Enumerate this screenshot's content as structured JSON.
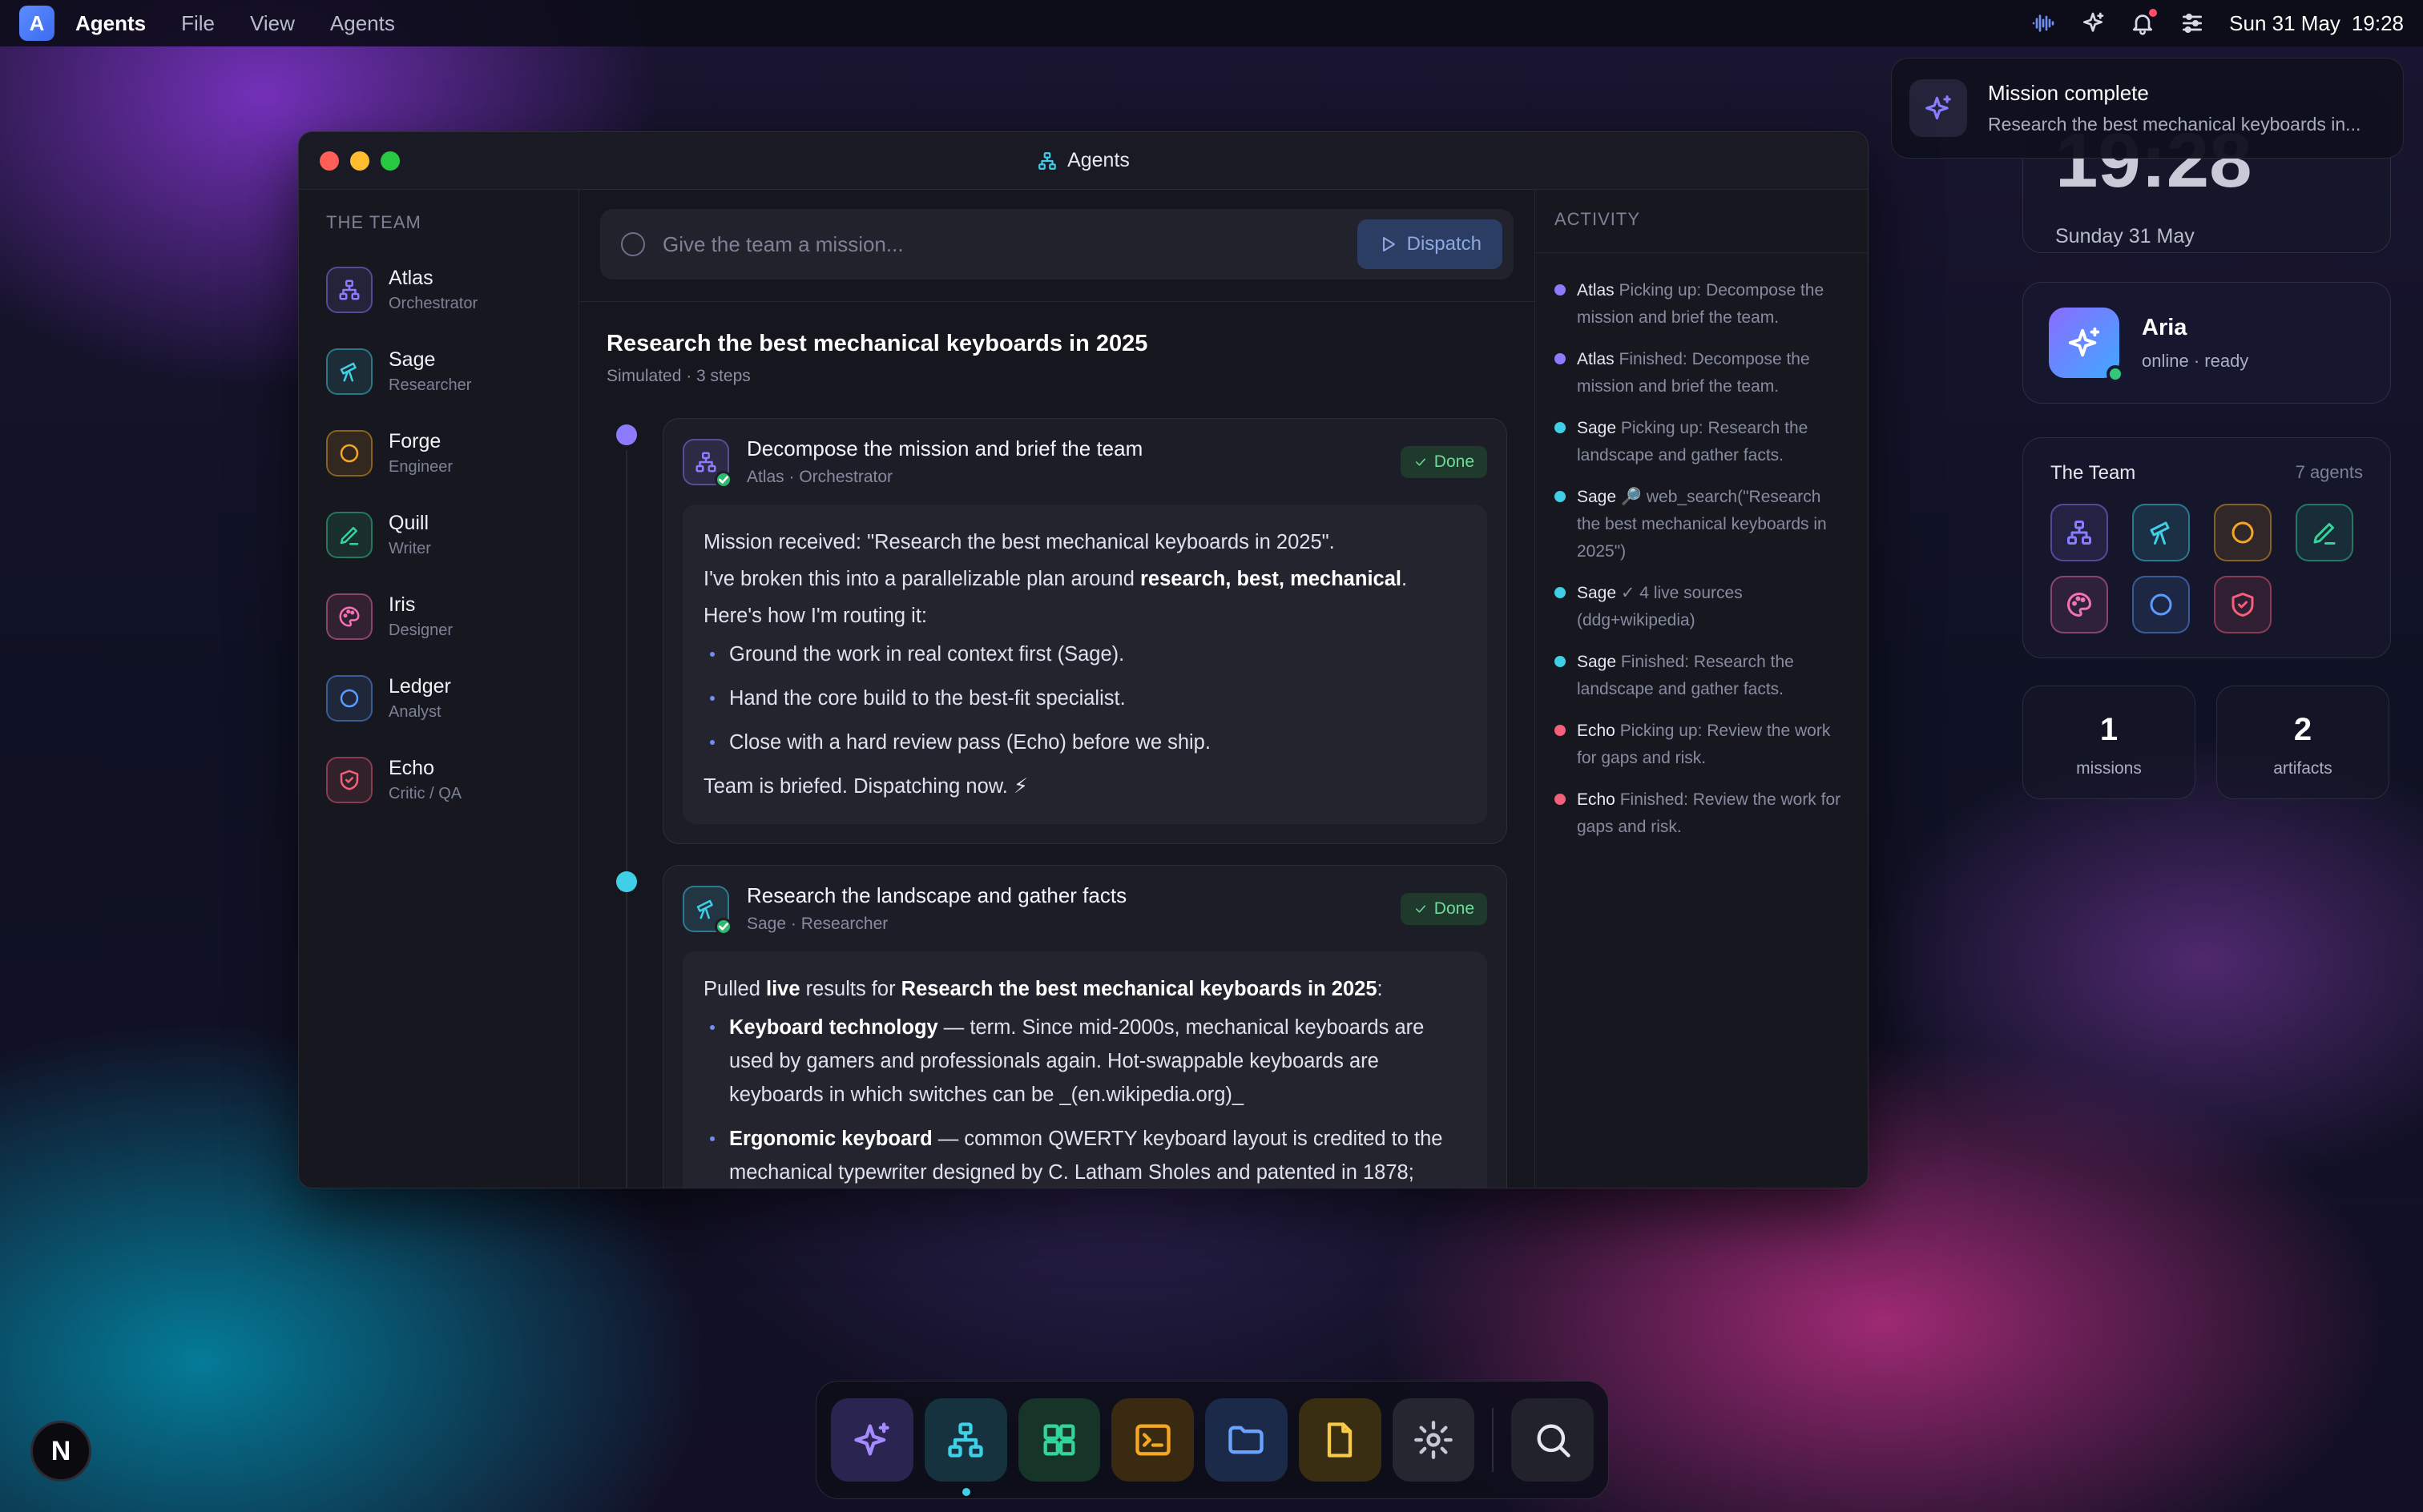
{
  "menubar": {
    "app_letter": "A",
    "app_name": "Agents",
    "menus": [
      "File",
      "View",
      "Agents"
    ],
    "date": "Sun 31 May",
    "time": "19:28"
  },
  "window": {
    "title": "Agents",
    "team_label": "THE TEAM",
    "agents": [
      {
        "name": "Atlas",
        "role": "Orchestrator",
        "color": "#8b7cff",
        "icon": "network-icon"
      },
      {
        "name": "Sage",
        "role": "Researcher",
        "color": "#3fd0e8",
        "icon": "telescope-icon"
      },
      {
        "name": "Forge",
        "role": "Engineer",
        "color": "#f5a623",
        "icon": "circle-icon"
      },
      {
        "name": "Quill",
        "role": "Writer",
        "color": "#34d399",
        "icon": "pen-icon"
      },
      {
        "name": "Iris",
        "role": "Designer",
        "color": "#f472b6",
        "icon": "palette-icon"
      },
      {
        "name": "Ledger",
        "role": "Analyst",
        "color": "#5b9bff",
        "icon": "circle-icon"
      },
      {
        "name": "Echo",
        "role": "Critic / QA",
        "color": "#f4607a",
        "icon": "shield-icon"
      }
    ],
    "mission_placeholder": "Give the team a mission...",
    "dispatch_label": "Dispatch",
    "feed": {
      "title": "Research the best mechanical keyboards in 2025",
      "meta": "Simulated · 3 steps",
      "steps": [
        {
          "title": "Decompose the mission and brief the team",
          "sub": "Atlas · Orchestrator",
          "status": "Done",
          "p1": "Mission received: \"Research the best mechanical keyboards in 2025\".",
          "p2a": "I've broken this into a parallelizable plan around ",
          "p2b": "research, best, mechanical",
          "p2c": ".",
          "p3": "Here's how I'm routing it:",
          "bullets": [
            "Ground the work in real context first (Sage).",
            "Hand the core build to the best-fit specialist.",
            "Close with a hard review pass (Echo) before we ship."
          ],
          "closing": "Team is briefed. Dispatching now. ⚡"
        },
        {
          "title": "Research the landscape and gather facts",
          "sub": "Sage · Researcher",
          "status": "Done",
          "p1a": "Pulled ",
          "p1b": "live",
          "p1c": " results for ",
          "p1d": "Research the best mechanical keyboards in 2025",
          "p1e": ":",
          "b1_title": "Keyboard technology",
          "b1_text": " — term. Since mid-2000s, mechanical keyboards are used by gamers and professionals again. Hot-swappable keyboards are keyboards in which switches can be _(en.wikipedia.org)_",
          "b2_title": "Ergonomic keyboard",
          "b2_text": " — common QWERTY keyboard layout is credited to the mechanical typewriter designed by C. Latham Sholes and patented in 1878;"
        }
      ]
    },
    "activity": {
      "label": "ACTIVITY",
      "items": [
        {
          "agent": "Atlas",
          "text": " Picking up: Decompose the mission and brief the team.",
          "color": "#8b7cff"
        },
        {
          "agent": "Atlas",
          "text": " Finished: Decompose the mission and brief the team.",
          "color": "#8b7cff"
        },
        {
          "agent": "Sage",
          "text": " Picking up: Research the landscape and gather facts.",
          "color": "#3fd0e8"
        },
        {
          "agent": "Sage",
          "text": " 🔎 web_search(\"Research the best mechanical keyboards in 2025\")",
          "color": "#3fd0e8"
        },
        {
          "agent": "Sage",
          "text": " ✓ 4 live sources (ddg+wikipedia)",
          "color": "#3fd0e8"
        },
        {
          "agent": "Sage",
          "text": " Finished: Research the landscape and gather facts.",
          "color": "#3fd0e8"
        },
        {
          "agent": "Echo",
          "text": " Picking up: Review the work for gaps and risk.",
          "color": "#f4607a"
        },
        {
          "agent": "Echo",
          "text": " Finished: Review the work for gaps and risk.",
          "color": "#f4607a"
        }
      ]
    }
  },
  "notification": {
    "title": "Mission complete",
    "body": "Research the best mechanical keyboards in..."
  },
  "clock_widget": {
    "time": "19:28",
    "date": "Sunday 31 May"
  },
  "aria": {
    "name": "Aria",
    "status": "online · ready"
  },
  "team_widget": {
    "title": "The Team",
    "count": "7 agents"
  },
  "stats": [
    {
      "value": "1",
      "label": "missions"
    },
    {
      "value": "2",
      "label": "artifacts"
    }
  ],
  "dock_badge": "N"
}
